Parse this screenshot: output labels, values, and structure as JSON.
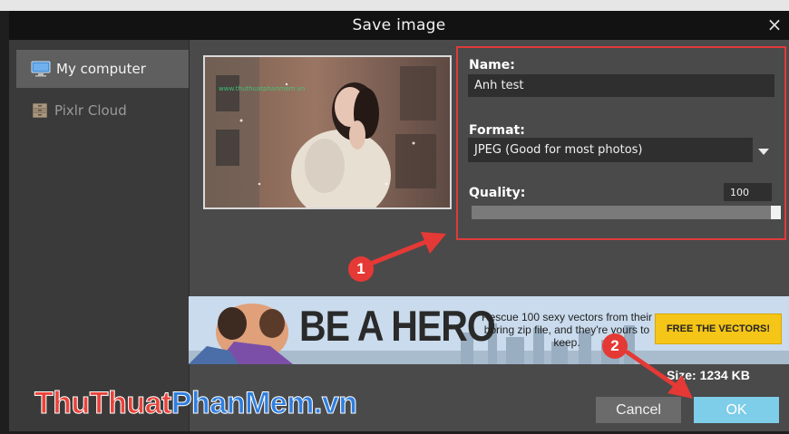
{
  "window": {
    "title": "Save image",
    "close_glyph": "×"
  },
  "sidebar": {
    "items": [
      {
        "label": "My computer",
        "icon": "monitor-icon",
        "active": true
      },
      {
        "label": "Pixlr Cloud",
        "icon": "cloud-storage-icon",
        "active": false
      }
    ]
  },
  "form": {
    "name_label": "Name:",
    "name_value": "Anh test",
    "format_label": "Format:",
    "format_value": "JPEG (Good for most photos)",
    "quality_label": "Quality:",
    "quality_value": "100",
    "quality_level_percent": 100
  },
  "ad": {
    "headline": "BE A HERO",
    "body": "Rescue 100 sexy vectors from their boring zip file, and they're yours to keep.",
    "cta": "FREE THE VECTORS!"
  },
  "size_info": "Size: 1234 KB",
  "buttons": {
    "cancel": "Cancel",
    "ok": "OK"
  },
  "annotations": {
    "badge_1": "1",
    "badge_2": "2",
    "color": "#e53935"
  },
  "watermark": {
    "part1": "ThuThuat",
    "part2": "PhanMem.vn"
  },
  "colors": {
    "ok_button": "#7ecde9",
    "cancel_button": "#6b6b6b",
    "highlight": "#e03a3a",
    "cta": "#f5c518"
  }
}
